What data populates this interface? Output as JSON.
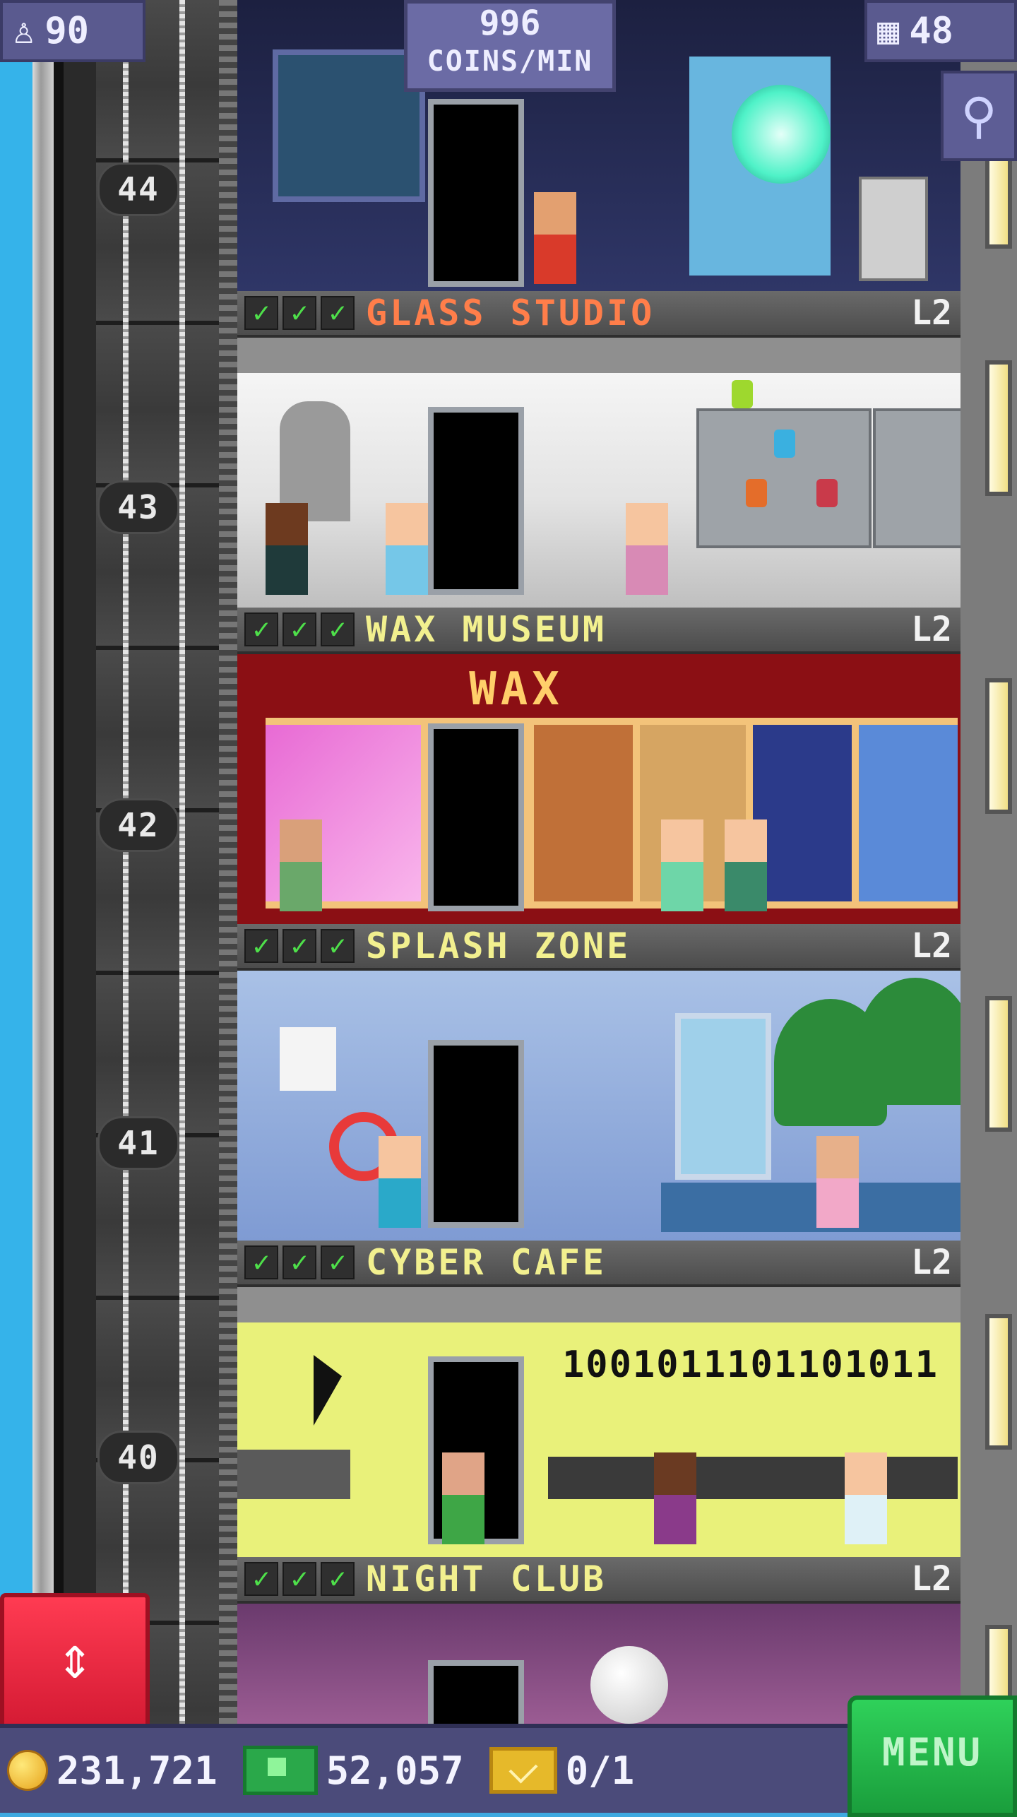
{
  "hud": {
    "population": "90",
    "coins_per_min_value": "996",
    "coins_per_min_unit": "COINS/MIN",
    "floor_count": "48"
  },
  "floors": [
    {
      "number": "44",
      "name": "GLASS STUDIO",
      "level": "L2",
      "checks": 3
    },
    {
      "number": "43",
      "name": "WAX MUSEUM",
      "level": "L2",
      "checks": 3
    },
    {
      "number": "42",
      "name": "SPLASH ZONE",
      "level": "L2",
      "checks": 3
    },
    {
      "number": "41",
      "name": "CYBER CAFE",
      "level": "L2",
      "checks": 3
    },
    {
      "number": "40",
      "name": "NIGHT CLUB",
      "level": "L2",
      "checks": 3
    }
  ],
  "floor_number_labels": [
    "44",
    "43",
    "42",
    "41",
    "40"
  ],
  "rooms": {
    "wax_sign": "WAX",
    "cyber_binary": "1001011101101011"
  },
  "bottom_bar": {
    "coins": "231,721",
    "bux": "52,057",
    "tickets": "0/1",
    "menu_label": "MENU"
  },
  "icons": {
    "population": "person-icon",
    "floors": "building-icon",
    "zoom": "magnifier-icon",
    "elevator": "up-down-arrows-icon",
    "coins": "coin-icon",
    "bux": "bux-icon",
    "tickets": "ticket-icon",
    "check": "check-icon"
  },
  "colors": {
    "check": "#4ee04a",
    "glass_studio_name": "#ff7e4a",
    "other_floor_name": "#f2f08f",
    "menu_button": "#1fbf4a",
    "elevator_button": "#e8233c",
    "hud": "#5a5a8f"
  }
}
